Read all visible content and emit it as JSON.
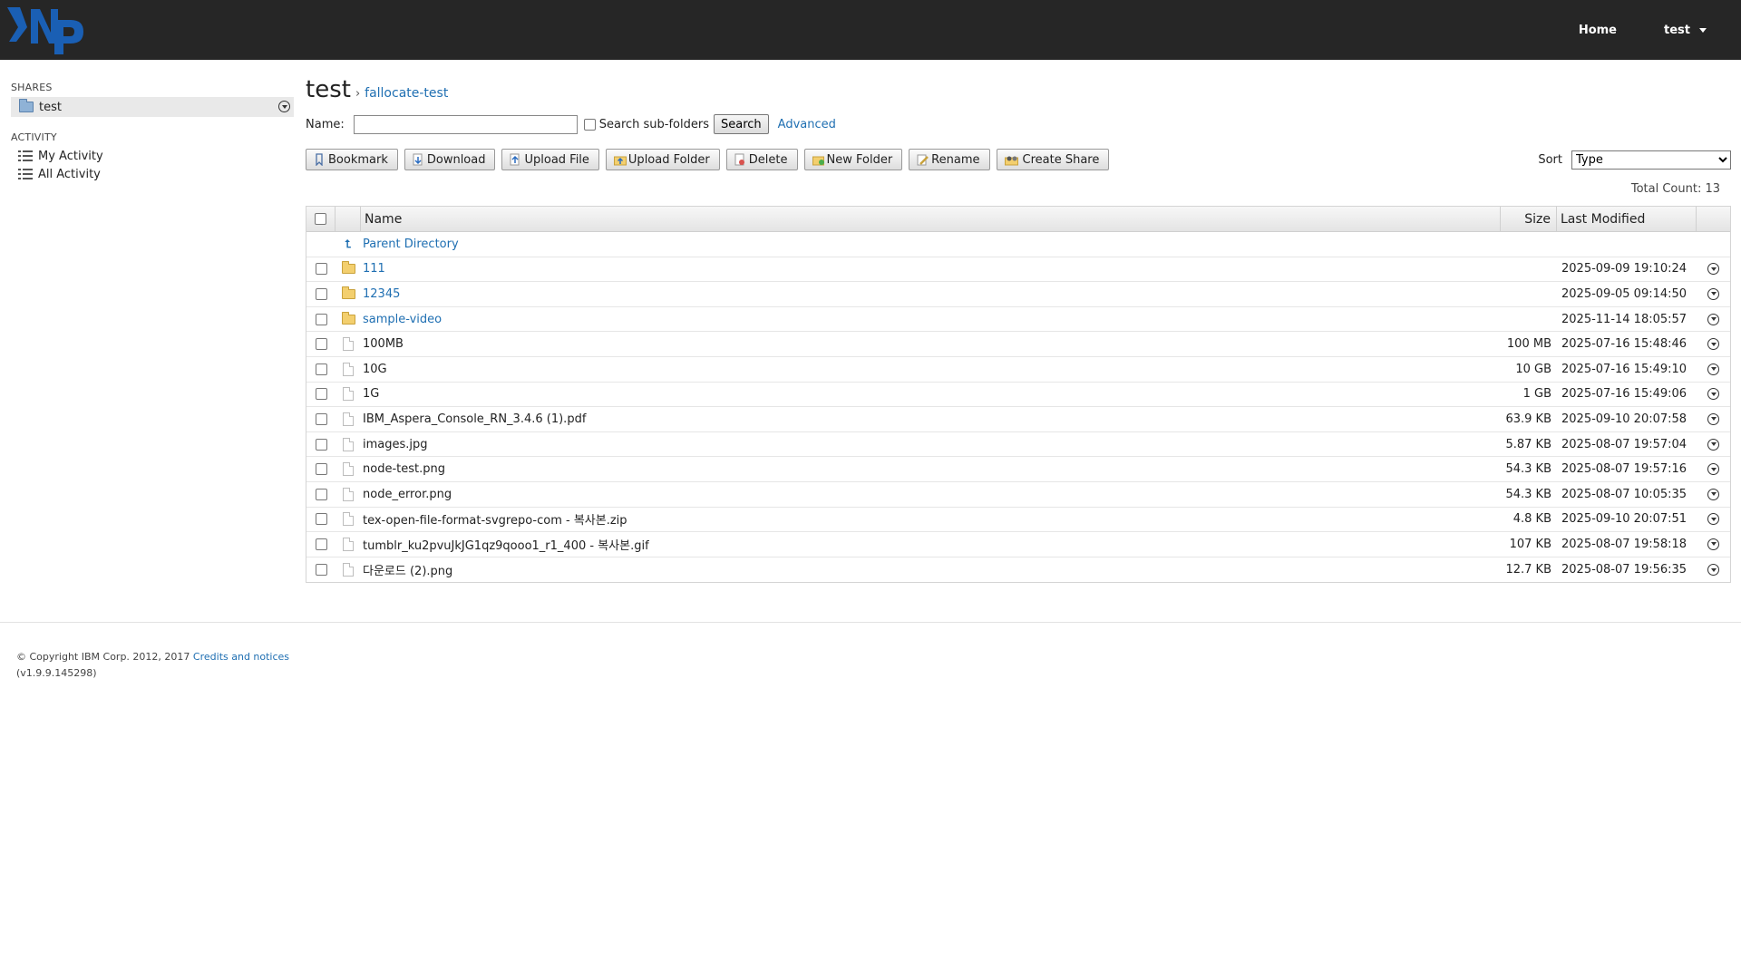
{
  "header": {
    "logo_icon": "np-logo-icon",
    "home_label": "Home",
    "user_label": "test"
  },
  "sidebar": {
    "shares_title": "SHARES",
    "shares": [
      {
        "label": "test"
      }
    ],
    "activity_title": "ACTIVITY",
    "activity_items": [
      {
        "label": "My Activity"
      },
      {
        "label": "All Activity"
      }
    ]
  },
  "breadcrumb": {
    "root": "test",
    "separator": "›",
    "current": "fallocate-test"
  },
  "search": {
    "name_label": "Name:",
    "name_value": "",
    "subfolders_label": "Search sub-folders",
    "search_button": "Search",
    "advanced_link": "Advanced"
  },
  "toolbar": {
    "bookmark": "Bookmark",
    "download": "Download",
    "upload_file": "Upload File",
    "upload_folder": "Upload Folder",
    "delete": "Delete",
    "new_folder": "New Folder",
    "rename": "Rename",
    "create_share": "Create Share"
  },
  "sort": {
    "label": "Sort",
    "selected": "Type"
  },
  "total_count": "Total Count: 13",
  "table": {
    "columns": {
      "name": "Name",
      "size": "Size",
      "modified": "Last Modified"
    },
    "parent_label": "Parent Directory",
    "rows": [
      {
        "name": "111",
        "type": "folder",
        "size": "",
        "modified": "2025-09-09 19:10:24"
      },
      {
        "name": "12345",
        "type": "folder",
        "size": "",
        "modified": "2025-09-05 09:14:50"
      },
      {
        "name": "sample-video",
        "type": "folder",
        "size": "",
        "modified": "2025-11-14 18:05:57"
      },
      {
        "name": "100MB",
        "type": "file",
        "size": "100 MB",
        "modified": "2025-07-16 15:48:46"
      },
      {
        "name": "10G",
        "type": "file",
        "size": "10 GB",
        "modified": "2025-07-16 15:49:10"
      },
      {
        "name": "1G",
        "type": "file",
        "size": "1 GB",
        "modified": "2025-07-16 15:49:06"
      },
      {
        "name": "IBM_Aspera_Console_RN_3.4.6 (1).pdf",
        "type": "file",
        "size": "63.9 KB",
        "modified": "2025-09-10 20:07:58"
      },
      {
        "name": "images.jpg",
        "type": "file",
        "size": "5.87 KB",
        "modified": "2025-08-07 19:57:04"
      },
      {
        "name": "node-test.png",
        "type": "file",
        "size": "54.3 KB",
        "modified": "2025-08-07 19:57:16"
      },
      {
        "name": "node_error.png",
        "type": "file",
        "size": "54.3 KB",
        "modified": "2025-08-07 10:05:35"
      },
      {
        "name": "tex-open-file-format-svgrepo-com - 복사본.zip",
        "type": "file",
        "size": "4.8 KB",
        "modified": "2025-09-10 20:07:51"
      },
      {
        "name": "tumblr_ku2pvuJkJG1qz9qooo1_r1_400 - 복사본.gif",
        "type": "file",
        "size": "107 KB",
        "modified": "2025-08-07 19:58:18"
      },
      {
        "name": "다운로드 (2).png",
        "type": "file",
        "size": "12.7 KB",
        "modified": "2025-08-07 19:56:35"
      }
    ]
  },
  "footer": {
    "copyright": "© Copyright IBM Corp. 2012, 2017",
    "credits_link": "Credits and notices",
    "version": "(v1.9.9.145298)"
  },
  "colors": {
    "header_bg": "#262626",
    "link": "#1f6fb2",
    "logo_blue": "#1a5fb4"
  }
}
